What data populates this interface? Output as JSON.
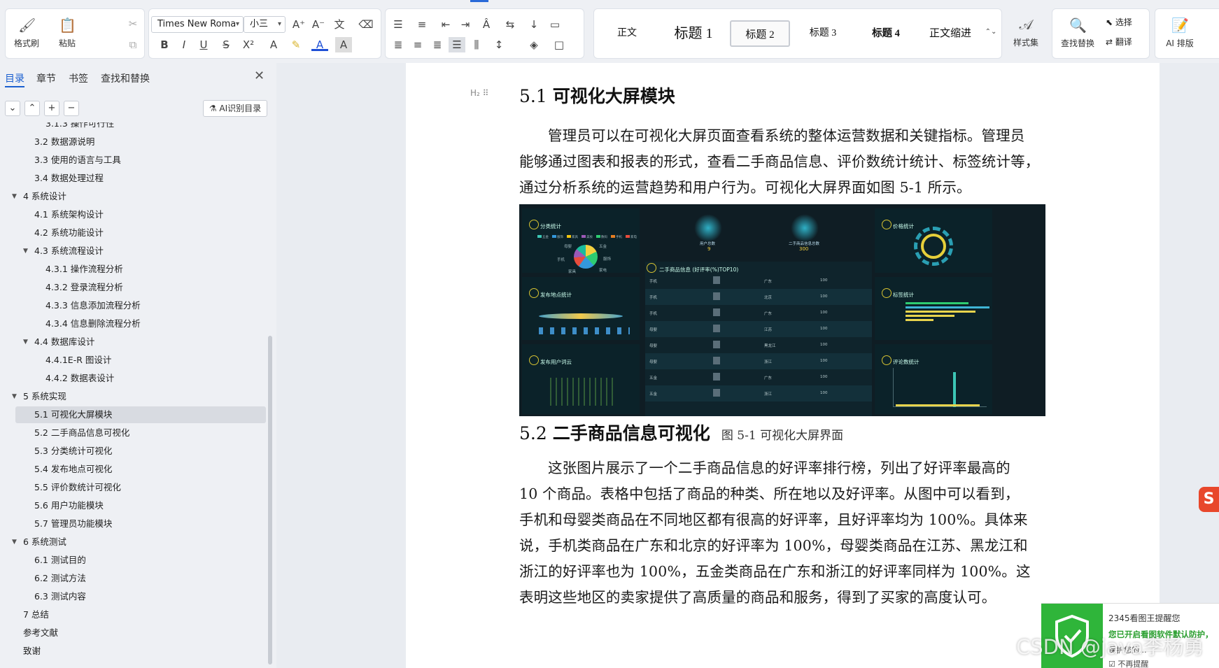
{
  "ribbon": {
    "format_painter": "格式刷",
    "paste": "粘贴",
    "font_family": "Times New Roma",
    "font_size": "小三",
    "styles": [
      "正文",
      "标题 1",
      "标题 2",
      "标题 3",
      "标题 4",
      "正文缩进"
    ],
    "style_set": "样式集",
    "find_replace": "查找替换",
    "select": "选择",
    "translate": "翻译",
    "ai_layout": "AI 排版"
  },
  "nav": {
    "tabs": [
      "目录",
      "章节",
      "书签",
      "查找和替换"
    ],
    "ai_button": "AI识别目录",
    "items": [
      {
        "label": "3.1.3 操作可行性",
        "level": 3
      },
      {
        "label": "3.2 数据源说明",
        "level": 2
      },
      {
        "label": "3.3 使用的语言与工具",
        "level": 2
      },
      {
        "label": "3.4 数据处理过程",
        "level": 2
      },
      {
        "label": "4 系统设计",
        "level": 1,
        "expanded": true
      },
      {
        "label": "4.1 系统架构设计",
        "level": 2
      },
      {
        "label": "4.2 系统功能设计",
        "level": 2
      },
      {
        "label": "4.3 系统流程设计",
        "level": 2,
        "expanded": true
      },
      {
        "label": "4.3.1 操作流程分析",
        "level": 3
      },
      {
        "label": "4.3.2 登录流程分析",
        "level": 3
      },
      {
        "label": "4.3.3 信息添加流程分析",
        "level": 3
      },
      {
        "label": "4.3.4 信息删除流程分析",
        "level": 3
      },
      {
        "label": "4.4 数据库设计",
        "level": 2,
        "expanded": true
      },
      {
        "label": "4.4.1E-R 图设计",
        "level": 3
      },
      {
        "label": "4.4.2 数据表设计",
        "level": 3
      },
      {
        "label": "5 系统实现",
        "level": 1,
        "expanded": true
      },
      {
        "label": "5.1 可视化大屏模块",
        "level": 2,
        "active": true
      },
      {
        "label": "5.2 二手商品信息可视化",
        "level": 2
      },
      {
        "label": "5.3 分类统计可视化",
        "level": 2
      },
      {
        "label": "5.4 发布地点可视化",
        "level": 2
      },
      {
        "label": "5.5 评价数统计可视化",
        "level": 2
      },
      {
        "label": "5.6 用户功能模块",
        "level": 2
      },
      {
        "label": "5.7 管理员功能模块",
        "level": 2
      },
      {
        "label": "6 系统测试",
        "level": 1,
        "expanded": true
      },
      {
        "label": "6.1 测试目的",
        "level": 2
      },
      {
        "label": "6.2 测试方法",
        "level": 2
      },
      {
        "label": "6.3 测试内容",
        "level": 2
      },
      {
        "label": "7 总结",
        "level": 1
      },
      {
        "label": "参考文献",
        "level": 1
      },
      {
        "label": "致谢",
        "level": 1
      }
    ]
  },
  "doc": {
    "heading_marker": "H₂",
    "section1": {
      "num": "5.1",
      "title": "可视化大屏模块",
      "lines": [
        "管理员可以在可视化大屏页面查看系统的整体运营数据和关键指标。管理员",
        "能够通过图表和报表的形式，查看二手商品信息、评价数统计统计、标签统计等，",
        "通过分析系统的运营趋势和用户行为。可视化大屏界面如图 5-1 所示。"
      ],
      "caption": "图 5-1  可视化大屏界面"
    },
    "section2": {
      "num": "5.2",
      "title": "二手商品信息可视化",
      "lines": [
        "这张图片展示了一个二手商品信息的好评率排行榜，列出了好评率最高的",
        "10 个商品。表格中包括了商品的种类、所在地以及好评率。从图中可以看到，",
        "手机和母婴类商品在不同地区都有很高的好评率，且好评率均为 100%。具体来",
        "说，手机类商品在广东和北京的好评率为 100%，母婴类商品在江苏、黑龙江和",
        "浙江的好评率也为 100%，五金类商品在广东和浙江的好评率同样为 100%。这",
        "表明这些地区的卖家提供了高质量的商品和服务，得到了买家的高度认可。"
      ]
    }
  },
  "dashboard": {
    "panels": {
      "category": "分类统计",
      "users_total_label": "用户总数",
      "users_total": "9",
      "goods_total_label": "二手商品信息总数",
      "goods_total": "300",
      "price": "价格统计",
      "place": "发布地点统计",
      "rank": "二手商品信息 (好评率(%)TOP10)",
      "tags": "标签统计",
      "wordcloud": "发布用户词云",
      "reviews": "评论数统计"
    },
    "legend": [
      "五金",
      "服饰",
      "家具",
      "美妆",
      "数码",
      "手机",
      "家电"
    ],
    "pie_labels": [
      "母婴",
      "手机",
      "五金",
      "服饰",
      "家电",
      "家具"
    ],
    "rank_rows": [
      {
        "type": "手机",
        "place": "广东",
        "rate": "100"
      },
      {
        "type": "手机",
        "place": "北京",
        "rate": "100"
      },
      {
        "type": "手机",
        "place": "广东",
        "rate": "100"
      },
      {
        "type": "母婴",
        "place": "江苏",
        "rate": "100"
      },
      {
        "type": "母婴",
        "place": "黑龙江",
        "rate": "100"
      },
      {
        "type": "母婴",
        "place": "浙江",
        "rate": "100"
      },
      {
        "type": "五金",
        "place": "广东",
        "rate": "100"
      },
      {
        "type": "五金",
        "place": "浙江",
        "rate": "100"
      }
    ]
  },
  "popup": {
    "title": "2345看图王提醒您",
    "line1": "您已开启看图软件默认防护，",
    "line2": "保护您的...",
    "dont_remind": "不再提醒"
  },
  "watermark": "CSDN @java李杨勇",
  "sogou": "S"
}
